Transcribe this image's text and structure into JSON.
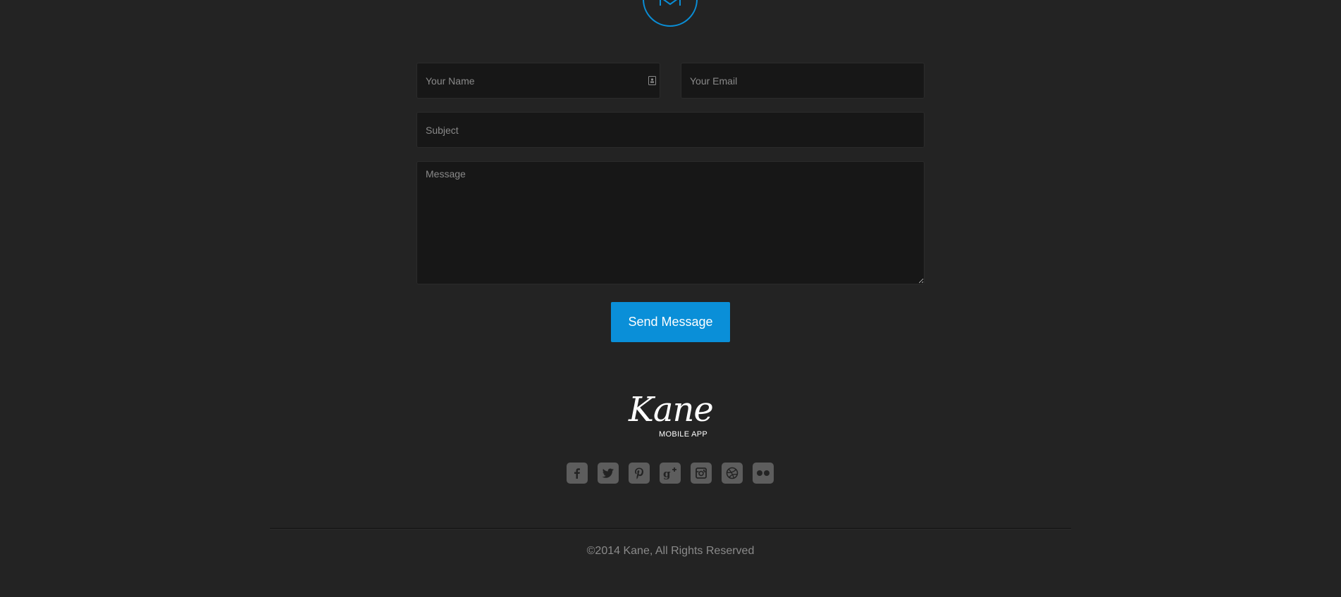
{
  "form": {
    "name_placeholder": "Your Name",
    "email_placeholder": "Your Email",
    "subject_placeholder": "Subject",
    "message_placeholder": "Message",
    "send_label": "Send Message"
  },
  "footer": {
    "logo_script": "Kane",
    "logo_subtitle": "MOBILE APP",
    "social_icons": [
      "facebook-icon",
      "twitter-icon",
      "pinterest-icon",
      "google-plus-icon",
      "instagram-icon",
      "dribbble-icon",
      "flickr-icon"
    ],
    "copyright": "©2014 Kane, All Rights Reserved"
  },
  "colors": {
    "background": "#232323",
    "field_background": "#171717",
    "accent": "#0a8fd8",
    "social_icon": "#5d5d5d",
    "muted_text": "#8a8a8a"
  },
  "icons": {
    "header": "envelope-icon",
    "name_field": "contact-card-icon"
  }
}
